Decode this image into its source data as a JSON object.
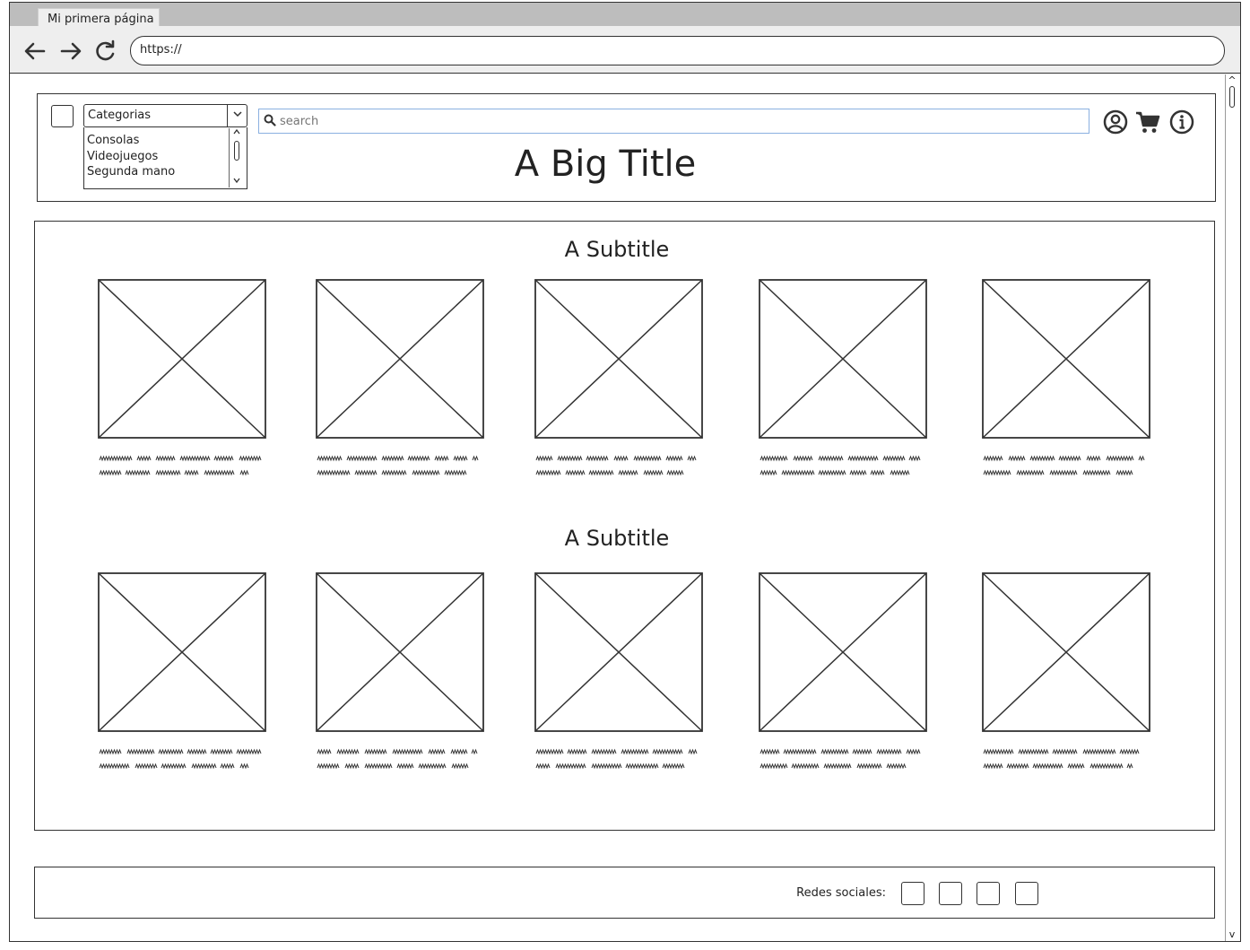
{
  "browser": {
    "tab_title": "Mi primera página",
    "url": "https://",
    "back_icon": "arrow-left-icon",
    "forward_icon": "arrow-right-icon",
    "reload_icon": "reload-icon"
  },
  "header": {
    "categories_label": "Categorias",
    "categories": [
      "Consolas",
      "Videojuegos",
      "Segunda mano"
    ],
    "search_placeholder": "search",
    "title": "A Big Title",
    "icons": [
      "user-icon",
      "cart-icon",
      "info-icon"
    ]
  },
  "sections": [
    {
      "subtitle": "A Subtitle",
      "products": 5
    },
    {
      "subtitle": "A Subtitle",
      "products": 5
    }
  ],
  "footer": {
    "social_label": "Redes sociales:",
    "social_buttons": 4
  }
}
